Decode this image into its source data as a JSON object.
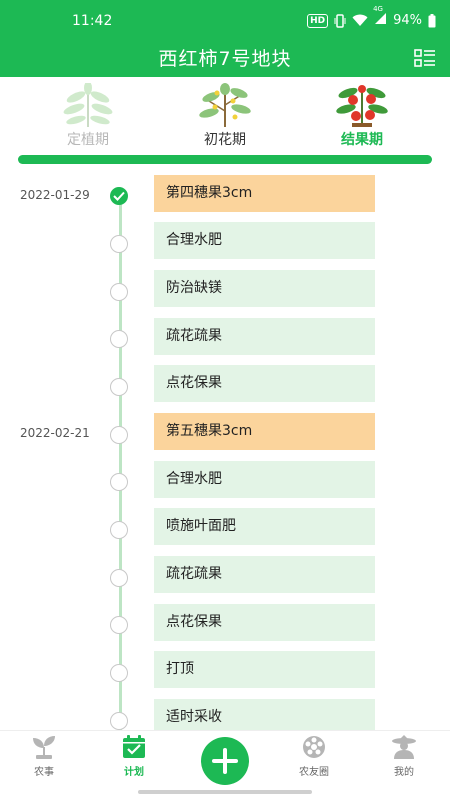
{
  "status_bar": {
    "time": "11:42",
    "hd": "HD",
    "network": "4G",
    "battery": "94%"
  },
  "header": {
    "title": "西红柿7号地块"
  },
  "stages": [
    {
      "label": "定植期",
      "state": "past"
    },
    {
      "label": "初花期",
      "state": "normal"
    },
    {
      "label": "结果期",
      "state": "active"
    }
  ],
  "timeline": {
    "dates": [
      "2022-01-29",
      "2022-02-21"
    ],
    "tasks": [
      {
        "label": "第四穗果3cm",
        "type": "milestone",
        "done": true
      },
      {
        "label": "合理水肥",
        "type": "normal",
        "done": false
      },
      {
        "label": "防治缺镁",
        "type": "normal",
        "done": false
      },
      {
        "label": "疏花疏果",
        "type": "normal",
        "done": false
      },
      {
        "label": "点花保果",
        "type": "normal",
        "done": false
      },
      {
        "label": "第五穗果3cm",
        "type": "milestone",
        "done": false
      },
      {
        "label": "合理水肥",
        "type": "normal",
        "done": false
      },
      {
        "label": "喷施叶面肥",
        "type": "normal",
        "done": false
      },
      {
        "label": "疏花疏果",
        "type": "normal",
        "done": false
      },
      {
        "label": "点花保果",
        "type": "normal",
        "done": false
      },
      {
        "label": "打顶",
        "type": "normal",
        "done": false
      },
      {
        "label": "适时采收",
        "type": "normal",
        "done": false
      }
    ]
  },
  "bottom_nav": [
    {
      "label": "农事",
      "icon": "sprout-icon",
      "active": false
    },
    {
      "label": "计划",
      "icon": "calendar-check-icon",
      "active": true
    },
    {
      "label": "农友圈",
      "icon": "community-icon",
      "active": false
    },
    {
      "label": "我的",
      "icon": "farmer-avatar-icon",
      "active": false
    }
  ],
  "colors": {
    "primary": "#1db954",
    "milestone": "#fbd49c",
    "task": "#e3f4e6"
  }
}
